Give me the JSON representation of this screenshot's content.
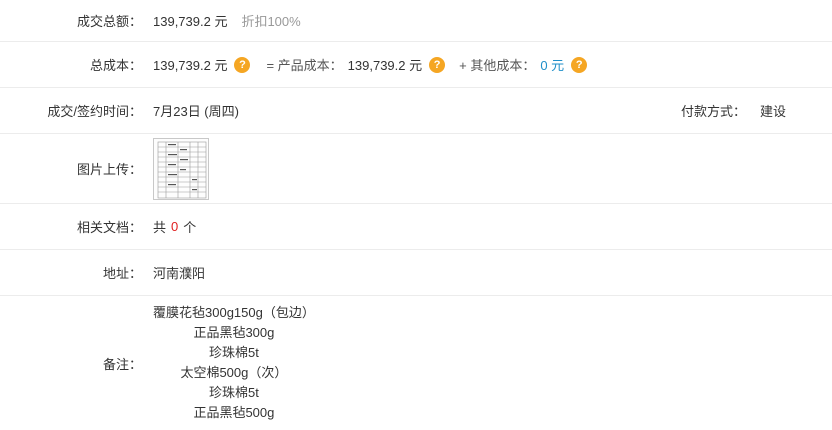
{
  "total_amount": {
    "label": "成交总额：",
    "value": "139,739.2 元",
    "discount": "折扣100%"
  },
  "total_cost": {
    "label": "总成本：",
    "value": "139,739.2 元",
    "product_cost_label": "= 产品成本：",
    "product_cost_value": "139,739.2 元",
    "other_cost_label": "+ 其他成本：",
    "other_cost_value": "0 元",
    "help_icon": "question-circle-icon"
  },
  "deal_time": {
    "label": "成交/签约时间：",
    "value": "7月23日 (周四)",
    "payment_label": "付款方式：",
    "payment_value": "建设"
  },
  "image_upload": {
    "label": "图片上传：",
    "thumbnail_icon": "document-thumbnail"
  },
  "documents": {
    "label": "相关文档：",
    "prefix": "共",
    "count": "0",
    "suffix": "个"
  },
  "address": {
    "label": "地址：",
    "value": "河南濮阳"
  },
  "remarks": {
    "label": "备注：",
    "lines": [
      "覆膜花毡300g150g（包边）",
      "正品黑毡300g",
      "珍珠棉5t",
      "太空棉500g（次）",
      "珍珠棉5t",
      "正品黑毡500g"
    ]
  },
  "colors": {
    "help_icon": "#f5a623",
    "zero_cost": "#1f8fc9",
    "doc_count": "#e02020",
    "divider": "#ececec"
  }
}
